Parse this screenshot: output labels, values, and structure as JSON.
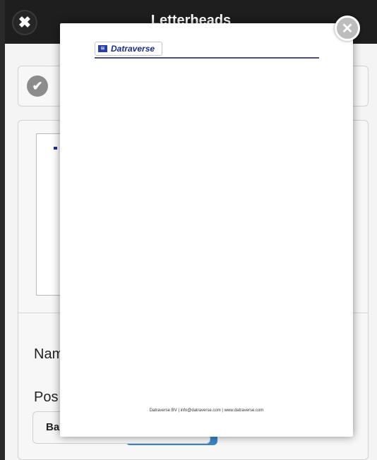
{
  "header": {
    "title": "Letterheads",
    "close_glyph": "✖"
  },
  "form": {
    "check_glyph": "✔",
    "name_label": "Nam",
    "position_label": "Pos",
    "position_value": "Ba"
  },
  "popup": {
    "close_glyph": "✕",
    "letterhead": {
      "logo_glyph": "≋",
      "logo_text": "Datraverse",
      "footer": "Datraverse BV | info@datraverse.com | www.datraverse.com"
    }
  },
  "colors": {
    "header_bg": "#1e1e1e",
    "brand_blue": "#1b2c8c",
    "accent_blue": "#3a86c8"
  }
}
